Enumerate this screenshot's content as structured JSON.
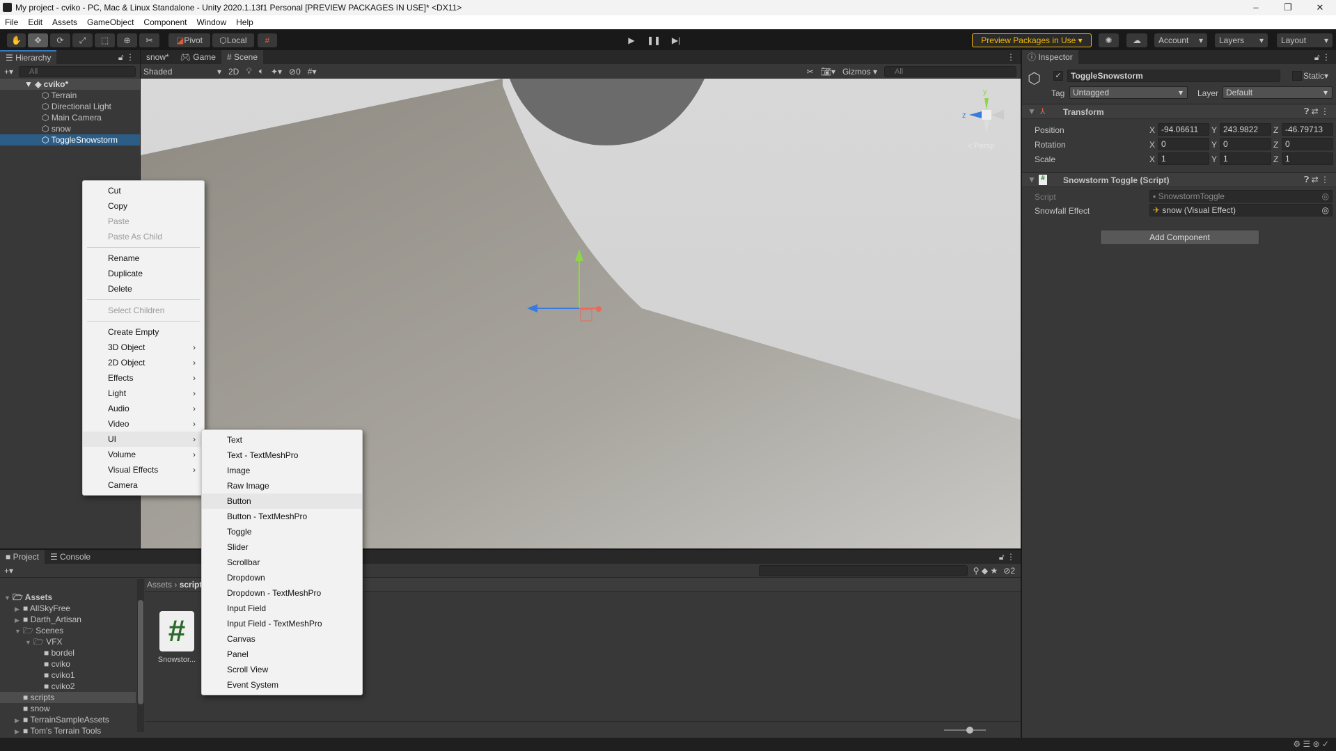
{
  "window": {
    "title": "My project - cviko - PC, Mac & Linux Standalone - Unity 2020.1.13f1 Personal [PREVIEW PACKAGES IN USE]* <DX11>",
    "minimize": "–",
    "maximize": "❐",
    "close": "✕"
  },
  "menubar": [
    "File",
    "Edit",
    "Assets",
    "GameObject",
    "Component",
    "Window",
    "Help"
  ],
  "toolbar": {
    "tools": [
      "hand-icon",
      "move-icon",
      "rotate-icon",
      "scale-icon",
      "rect-icon",
      "transform-icon",
      "custom-tool-icon"
    ],
    "pivot": "Pivot",
    "local": "Local",
    "preview_packages": "Preview Packages in Use ▾",
    "account": "Account",
    "layers": "Layers",
    "layout": "Layout",
    "accent": "#f4bc02"
  },
  "hierarchy": {
    "tab": "Hierarchy",
    "search_placeholder": "All",
    "scene": "cviko*",
    "items": [
      "Terrain",
      "Directional Light",
      "Main Camera",
      "snow",
      "ToggleSnowstorm"
    ],
    "selected": "ToggleSnowstorm"
  },
  "scene_tabs": [
    {
      "label": "snow*"
    },
    {
      "label": "Game"
    },
    {
      "label": "Scene"
    }
  ],
  "scene_toolbar": {
    "shading": "Shaded",
    "mode2d": "2D",
    "hidden_count": "0",
    "gizmos": "Gizmos",
    "search_placeholder": "All"
  },
  "gizmo": {
    "y": "y",
    "z": "z",
    "persp": "< Persp"
  },
  "context_menu": {
    "items": [
      {
        "label": "Cut",
        "enabled": true
      },
      {
        "label": "Copy",
        "enabled": true
      },
      {
        "label": "Paste",
        "enabled": false
      },
      {
        "label": "Paste As Child",
        "enabled": false
      },
      {
        "sep": true
      },
      {
        "label": "Rename",
        "enabled": true
      },
      {
        "label": "Duplicate",
        "enabled": true
      },
      {
        "label": "Delete",
        "enabled": true
      },
      {
        "sep": true
      },
      {
        "label": "Select Children",
        "enabled": false
      },
      {
        "sep": true
      },
      {
        "label": "Create Empty",
        "enabled": true
      },
      {
        "label": "3D Object",
        "sub": true
      },
      {
        "label": "2D Object",
        "sub": true
      },
      {
        "label": "Effects",
        "sub": true
      },
      {
        "label": "Light",
        "sub": true
      },
      {
        "label": "Audio",
        "sub": true
      },
      {
        "label": "Video",
        "sub": true
      },
      {
        "label": "UI",
        "sub": true,
        "open": true
      },
      {
        "label": "Volume",
        "sub": true
      },
      {
        "label": "Visual Effects",
        "sub": true
      },
      {
        "label": "Camera",
        "enabled": true
      }
    ]
  },
  "ui_submenu": {
    "items": [
      "Text",
      "Text - TextMeshPro",
      "Image",
      "Raw Image",
      "Button",
      "Button - TextMeshPro",
      "Toggle",
      "Slider",
      "Scrollbar",
      "Dropdown",
      "Dropdown - TextMeshPro",
      "Input Field",
      "Input Field - TextMeshPro",
      "Canvas",
      "Panel",
      "Scroll View",
      "Event System"
    ],
    "highlighted": "Button"
  },
  "inspector": {
    "tab": "Inspector",
    "object_name": "ToggleSnowstorm",
    "active": true,
    "static": "Static",
    "tag_label": "Tag",
    "tag": "Untagged",
    "layer_label": "Layer",
    "layer": "Default",
    "transform": {
      "title": "Transform",
      "position": {
        "label": "Position",
        "x": "-94.06611",
        "y": "243.9822",
        "z": "-46.79713"
      },
      "rotation": {
        "label": "Rotation",
        "x": "0",
        "y": "0",
        "z": "0"
      },
      "scale": {
        "label": "Scale",
        "x": "1",
        "y": "1",
        "z": "1"
      }
    },
    "script_component": {
      "title": "Snowstorm Toggle (Script)",
      "script_label": "Script",
      "script_value": "SnowstormToggle",
      "effect_label": "Snowfall Effect",
      "effect_value": "snow (Visual Effect)"
    },
    "add_component": "Add Component"
  },
  "project": {
    "tabs": [
      "Project",
      "Console"
    ],
    "breadcrumb": [
      "Assets",
      "scripts"
    ],
    "hidden_count": "2",
    "tree": [
      {
        "label": "Assets",
        "depth": 0,
        "bold": true,
        "open": true
      },
      {
        "label": "AllSkyFree",
        "depth": 1,
        "arrow": "▶"
      },
      {
        "label": "Darth_Artisan",
        "depth": 1,
        "arrow": "▶"
      },
      {
        "label": "Scenes",
        "depth": 1,
        "arrow": "▼"
      },
      {
        "label": "VFX",
        "depth": 2,
        "arrow": "▼"
      },
      {
        "label": "bordel",
        "depth": 3
      },
      {
        "label": "cviko",
        "depth": 3
      },
      {
        "label": "cviko1",
        "depth": 3
      },
      {
        "label": "cviko2",
        "depth": 3
      },
      {
        "label": "scripts",
        "depth": 1,
        "selected": true
      },
      {
        "label": "snow",
        "depth": 1
      },
      {
        "label": "TerrainSampleAssets",
        "depth": 1,
        "arrow": "▶"
      },
      {
        "label": "Tom's Terrain Tools",
        "depth": 1,
        "arrow": "▶"
      }
    ],
    "asset": {
      "name": "Snowstor...",
      "icon": "#"
    }
  }
}
